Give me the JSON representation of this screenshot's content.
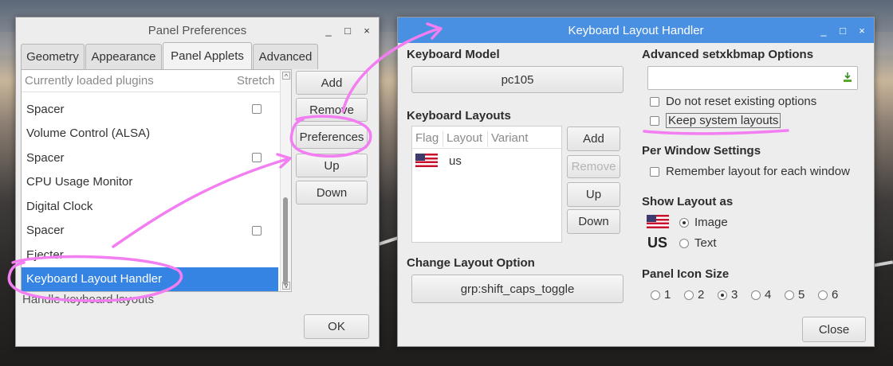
{
  "colors": {
    "selection": "#3584e4",
    "titlebar_active": "#4a90e2",
    "annotation": "#f27ef2"
  },
  "panel_prefs": {
    "title": "Panel Preferences",
    "controls": [
      "_",
      "□",
      "×"
    ],
    "tabs": [
      "Geometry",
      "Appearance",
      "Panel Applets",
      "Advanced"
    ],
    "active_tab": "Panel Applets",
    "list_headers": {
      "plugins": "Currently loaded plugins",
      "stretch": "Stretch"
    },
    "plugins": [
      {
        "name": "Spacer",
        "stretch": true
      },
      {
        "name": "Volume Control (ALSA)",
        "stretch": false
      },
      {
        "name": "Spacer",
        "stretch": true
      },
      {
        "name": "CPU Usage Monitor",
        "stretch": false
      },
      {
        "name": "Digital Clock",
        "stretch": false
      },
      {
        "name": "Spacer",
        "stretch": true
      },
      {
        "name": "Ejecter",
        "stretch": false
      },
      {
        "name": "Keyboard Layout Handler",
        "stretch": false,
        "selected": true
      }
    ],
    "description": "Handle keyboard layouts",
    "buttons": {
      "add": "Add",
      "remove": "Remove",
      "preferences": "Preferences",
      "up": "Up",
      "down": "Down",
      "ok": "OK"
    }
  },
  "kbd": {
    "title": "Keyboard Layout Handler",
    "controls": [
      "_",
      "□",
      "×"
    ],
    "model_label": "Keyboard Model",
    "model_value": "pc105",
    "layouts_label": "Keyboard Layouts",
    "layout_headers": [
      "Flag",
      "Layout",
      "Variant"
    ],
    "layouts": [
      {
        "flag_icon": "us-flag-icon",
        "layout": "us",
        "variant": ""
      }
    ],
    "layout_buttons": {
      "add": "Add",
      "remove": "Remove",
      "up": "Up",
      "down": "Down"
    },
    "change_option_label": "Change Layout Option",
    "change_option_value": "grp:shift_caps_toggle",
    "advanced_label": "Advanced setxkbmap Options",
    "advanced_value": "",
    "do_not_reset": "Do not reset existing options",
    "keep_system": "Keep system layouts",
    "per_window_label": "Per Window Settings",
    "remember_layout": "Remember layout for each window",
    "show_layout_label": "Show Layout as",
    "show_image": "Image",
    "show_text": "Text",
    "text_sample": "US",
    "icon_size_label": "Panel Icon Size",
    "icon_sizes": [
      "1",
      "2",
      "3",
      "4",
      "5",
      "6"
    ],
    "icon_size_selected": "3",
    "close": "Close"
  }
}
